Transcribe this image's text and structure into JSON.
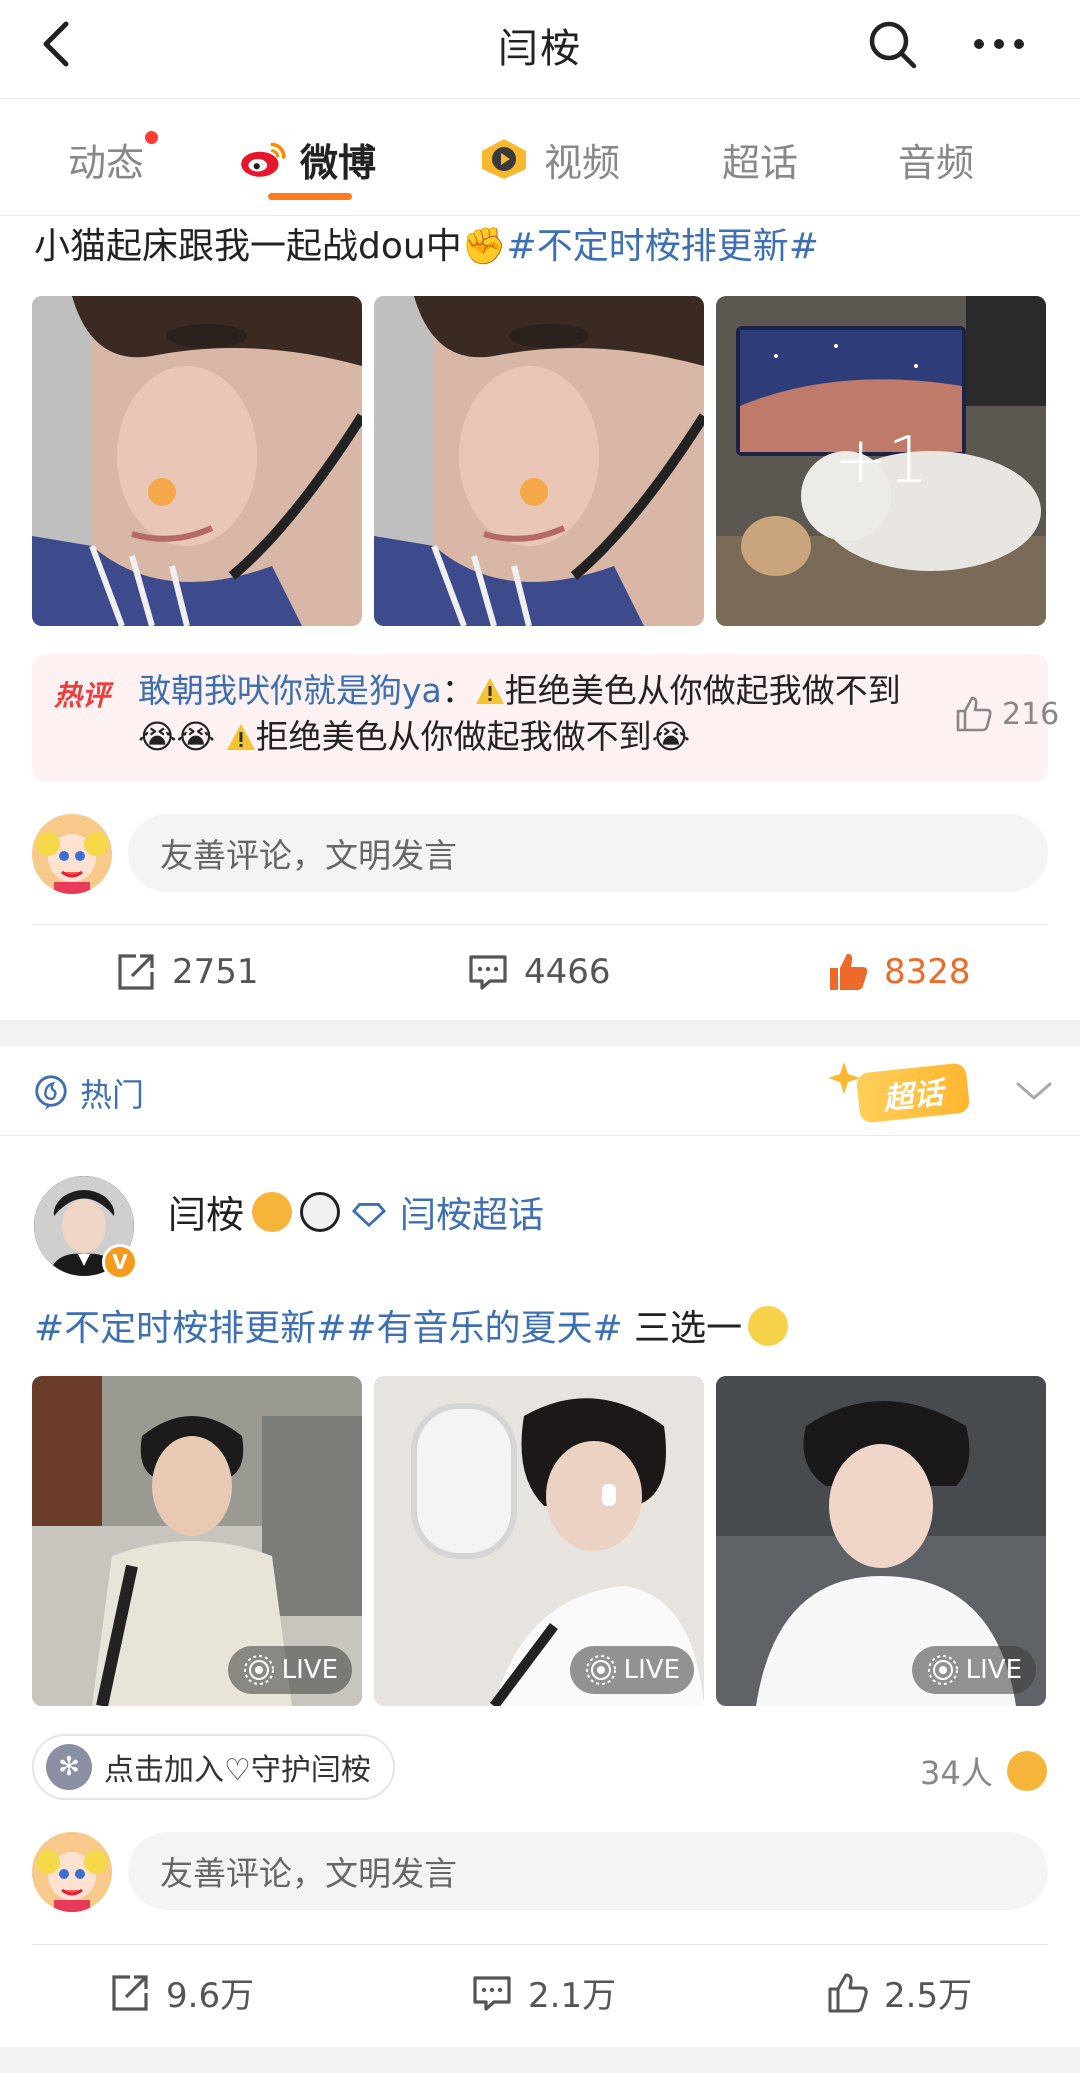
{
  "header": {
    "title": "闫桉"
  },
  "tabs": [
    {
      "label": "动态",
      "has_dot": true
    },
    {
      "label": "微博",
      "active": true
    },
    {
      "label": "视频"
    },
    {
      "label": "超话"
    },
    {
      "label": "音频"
    }
  ],
  "post1": {
    "text": "小猫起床跟我一起战dou中",
    "emoji": "✊",
    "topic": "#不定时桉排更新#",
    "image_overlay": "+1",
    "hot_comment": {
      "badge": "热评",
      "user": "敢朝我吠你就是狗ya",
      "colon": "：",
      "part1": "拒绝美色从你做起我做不到",
      "emojis1": "😭😭",
      "part2": "拒绝美色从你做起我做不到",
      "emojis2": "😭",
      "likes": "216"
    },
    "comment_placeholder": "友善评论，文明发言",
    "actions": {
      "reposts": "2751",
      "comments": "4466",
      "likes": "8328"
    }
  },
  "section": {
    "hot_label": "热门",
    "chaohua_badge": "超话"
  },
  "post2": {
    "author": "闫桉",
    "supertopic": "闫桉超话",
    "topic1": "#不定时桉排更新#",
    "topic2": "#有音乐的夏天#",
    "text": " 三选一",
    "live_label": "LIVE",
    "join_label": "点击加入♡守护闫桉",
    "members": "34人",
    "comment_placeholder": "友善评论，文明发言",
    "actions": {
      "reposts": "9.6万",
      "comments": "2.1万",
      "likes": "2.5万"
    }
  },
  "colors": {
    "accent": "#ff7a1a",
    "link": "#3c6fb3",
    "liked": "#ee6a2a",
    "hot_badge": "#ee3d3d"
  }
}
